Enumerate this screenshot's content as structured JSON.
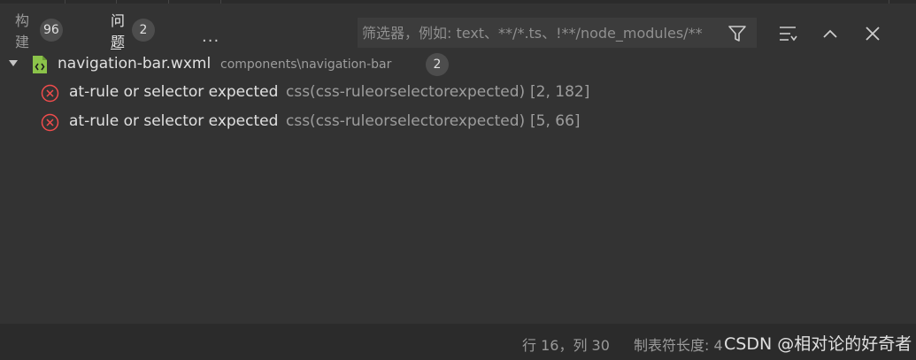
{
  "tabs": [
    {
      "label": "构建",
      "badge": "96",
      "active": false
    },
    {
      "label": "问题",
      "badge": "2",
      "active": true
    }
  ],
  "more_label": "···",
  "filter": {
    "placeholder": "筛选器，例如: text、**/*.ts、!**/node_modules/**"
  },
  "icons": {
    "filter": "filter-icon",
    "collapse_all": "collapse-all-icon",
    "maximize": "chevron-up-icon",
    "close": "close-icon",
    "file": "wxml-file-icon",
    "error": "error-circle-icon"
  },
  "colors": {
    "error": "#f14c4c",
    "file_icon": "#8bc34a"
  },
  "problems": {
    "file": {
      "name": "navigation-bar.wxml",
      "path": "components\\navigation-bar",
      "count": "2"
    },
    "items": [
      {
        "message": "at-rule or selector expected",
        "source": "css(css-ruleorselectorexpected)",
        "position": "[2, 182]"
      },
      {
        "message": "at-rule or selector expected",
        "source": "css(css-ruleorselectorexpected)",
        "position": "[5, 66]"
      }
    ]
  },
  "status": {
    "cursor": "行 16，列 30",
    "tab_size": "制表符长度: 4",
    "watermark": "CSDN @相对论的好奇者"
  }
}
